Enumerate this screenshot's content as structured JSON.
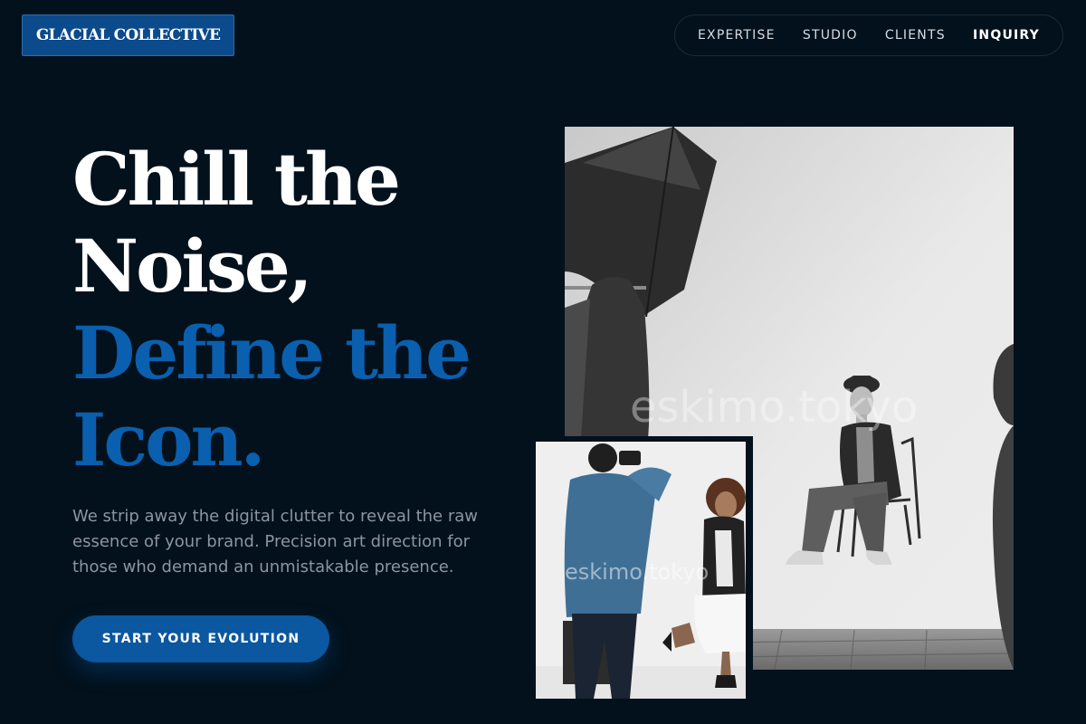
{
  "brand": {
    "logo_text": "GLACIAL COLLECTIVE"
  },
  "nav": {
    "items": [
      {
        "label": "EXPERTISE"
      },
      {
        "label": "STUDIO"
      },
      {
        "label": "CLIENTS"
      },
      {
        "label": "INQUIRY",
        "active": true
      }
    ]
  },
  "hero": {
    "headline_lines": [
      "Chill the",
      "Noise,",
      "Define the",
      "Icon."
    ],
    "description": "We strip away the digital clutter to reveal the raw essence of your brand. Precision art direction for those who demand an unmistakable presence.",
    "cta_label": "START YOUR EVOLUTION"
  },
  "images": {
    "main": {
      "subject": "monochrome-studio-model-seated-on-chair",
      "watermark": "eskimo.tokyo"
    },
    "inset": {
      "subject": "photographer-shooting-dancing-model",
      "watermark": "eskimo.tokyo"
    }
  },
  "colors": {
    "background": "#02111c",
    "accent": "#0a5fae",
    "button": "#0b57a0",
    "body_text": "#8c96a1"
  }
}
